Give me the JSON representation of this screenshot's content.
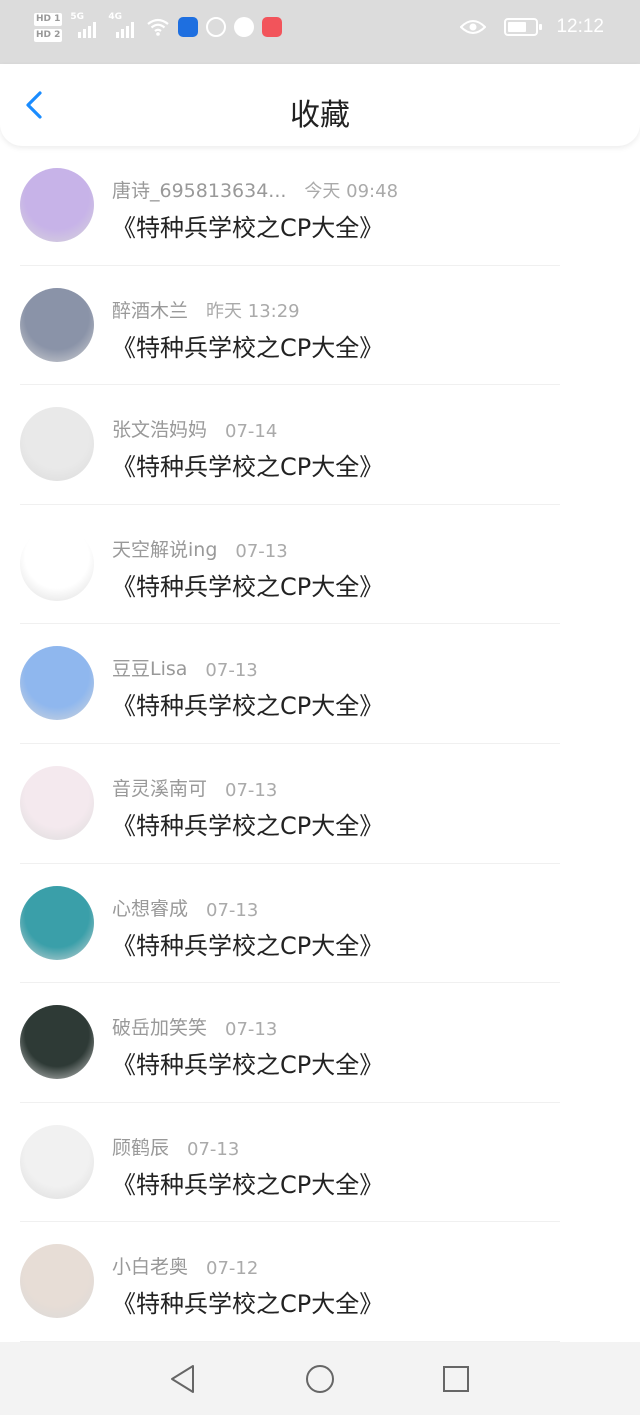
{
  "status_bar": {
    "hd_badges": [
      "HD 1",
      "HD 2"
    ],
    "network_1": "5G",
    "network_2": "4G",
    "time": "12:12",
    "icons": [
      "signal-icon",
      "wifi-icon",
      "notification-app-icon",
      "eye-icon",
      "battery-icon"
    ]
  },
  "header": {
    "title": "收藏",
    "back_icon": "chevron-left-icon"
  },
  "favorites": [
    {
      "user": "唐诗_695813634...",
      "time": "今天 09:48",
      "title": "《特种兵学校之CP大全》",
      "avatar_color": "#c7b3e8"
    },
    {
      "user": "醉酒木兰",
      "time": "昨天 13:29",
      "title": "《特种兵学校之CP大全》",
      "avatar_color": "#8a93a8"
    },
    {
      "user": "张文浩妈妈",
      "time": "07-14",
      "title": "《特种兵学校之CP大全》",
      "avatar_color": "#e9e9e9"
    },
    {
      "user": "天空解说ing",
      "time": "07-13",
      "title": "《特种兵学校之CP大全》",
      "avatar_color": "#ffffff"
    },
    {
      "user": "豆豆Lisa",
      "time": "07-13",
      "title": "《特种兵学校之CP大全》",
      "avatar_color": "#8fb7ee"
    },
    {
      "user": "音灵溪南可",
      "time": "07-13",
      "title": "《特种兵学校之CP大全》",
      "avatar_color": "#f4e9ee"
    },
    {
      "user": "心想睿成",
      "time": "07-13",
      "title": "《特种兵学校之CP大全》",
      "avatar_color": "#3a9fa9"
    },
    {
      "user": "破岳加笑笑",
      "time": "07-13",
      "title": "《特种兵学校之CP大全》",
      "avatar_color": "#2e3a36"
    },
    {
      "user": "顾鹤辰",
      "time": "07-13",
      "title": "《特种兵学校之CP大全》",
      "avatar_color": "#f1f1f1"
    },
    {
      "user": "小白老奥",
      "time": "07-12",
      "title": "《特种兵学校之CP大全》",
      "avatar_color": "#e7ddd6"
    }
  ],
  "nav": {
    "icons": [
      "back-triangle-icon",
      "home-circle-icon",
      "recents-square-icon"
    ]
  },
  "colors": {
    "accent": "#1a8cff",
    "text_primary": "#222222",
    "text_secondary": "#999999",
    "status_bar_bg": "#dcdcdc"
  }
}
